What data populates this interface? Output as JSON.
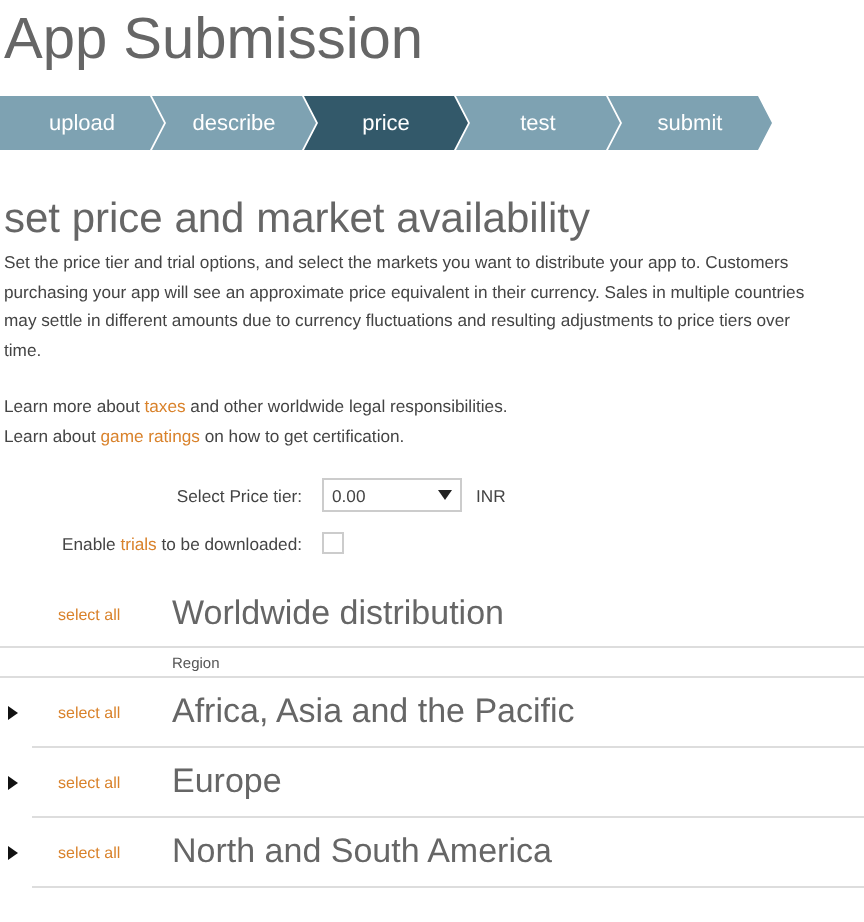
{
  "page_title": "App Submission",
  "steps": [
    {
      "label": "upload",
      "selected": false
    },
    {
      "label": "describe",
      "selected": false
    },
    {
      "label": "price",
      "selected": true
    },
    {
      "label": "test",
      "selected": false
    },
    {
      "label": "submit",
      "selected": false
    }
  ],
  "section_title": "set price and market availability",
  "intro": "Set the price tier and trial options, and select the markets you want to distribute your app to. Customers purchasing your app will see an approximate price equivalent in their currency. Sales in multiple countries may settle in different amounts due to currency fluctuations and resulting adjustments to price tiers over time.",
  "learn_lines": [
    {
      "before": "Learn more about",
      "link": "taxes",
      "after": "and other worldwide legal responsibilities."
    },
    {
      "before": "Learn about",
      "link": "game ratings",
      "after": " on how to get certification."
    }
  ],
  "price_tier": {
    "label": "Select Price tier:",
    "value": "0.00",
    "currency": "INR"
  },
  "trials": {
    "before": "Enable",
    "link": "trials",
    "after": "to be downloaded:",
    "checked": false
  },
  "worldwide": {
    "select_all": "select all",
    "title": "Worldwide distribution",
    "column": "Region"
  },
  "regions": [
    {
      "name": "Africa, Asia and the Pacific",
      "select_all": "select all",
      "expanded": false
    },
    {
      "name": "Europe",
      "select_all": "select all",
      "expanded": false
    },
    {
      "name": "North and South America",
      "select_all": "select all",
      "expanded": false
    }
  ]
}
